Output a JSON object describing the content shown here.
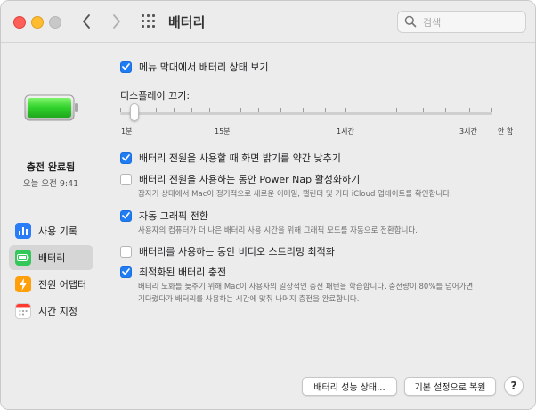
{
  "window": {
    "title": "배터리"
  },
  "search": {
    "placeholder": "검색",
    "value": ""
  },
  "sidebar": {
    "status": "충전 완료됨",
    "time": "오늘 오전 9:41",
    "battery_level": 1.0,
    "items": [
      {
        "label": "사용 기록",
        "icon": "chart-icon",
        "color": "#2a7df6",
        "active": false
      },
      {
        "label": "배터리",
        "icon": "battery-icon",
        "color": "#34c759",
        "active": true
      },
      {
        "label": "전원 어댑터",
        "icon": "bolt-icon",
        "color": "#ff9f0a",
        "active": false
      },
      {
        "label": "시간 지정",
        "icon": "calendar-icon",
        "color": "#ff3b30",
        "active": false
      }
    ]
  },
  "options": {
    "menu_bar": {
      "label": "메뉴 막대에서 배터리 상태 보기",
      "checked": true
    },
    "dim_display": {
      "label": "배터리 전원을 사용할 때 화면 밝기를 약간 낮추기",
      "checked": true
    },
    "power_nap": {
      "label": "배터리 전원을 사용하는 동안 Power Nap 활성화하기",
      "checked": false,
      "desc": "잠자기 상태에서 Mac이 정기적으로 새로운 이메일, 캘린더 및 기타 iCloud 업데이트를 확인합니다."
    },
    "auto_graphics": {
      "label": "자동 그래픽 전환",
      "checked": true,
      "desc": "사용자의 컴퓨터가 더 나은 배터리 사용 시간을 위해 그래픽 모드를 자동으로 전환합니다."
    },
    "video_streaming": {
      "label": "배터리를 사용하는 동안 비디오 스트리밍 최적화",
      "checked": false
    },
    "optimized_charging": {
      "label": "최적화된 배터리 충전",
      "checked": true,
      "desc1": "배터리 노화를 늦추기 위해 Mac이 사용자의 일상적인 충전 패턴을 학습합니다. 충전량이 80%를 넘어가면",
      "desc2": "기다렸다가 배터리를 사용하는 시간에 맞춰 나머지 충전을 완료합니다."
    }
  },
  "display_off": {
    "title": "디스플레이 끄기:",
    "value": "1분",
    "ticks": {
      "t1": "1분",
      "t15": "15분",
      "t1h": "1시간",
      "t3h": "3시간",
      "never": "안 함"
    }
  },
  "buttons": {
    "battery_health": "배터리 성능 상태...",
    "restore_defaults": "기본 설정으로 복원",
    "help": "?"
  }
}
